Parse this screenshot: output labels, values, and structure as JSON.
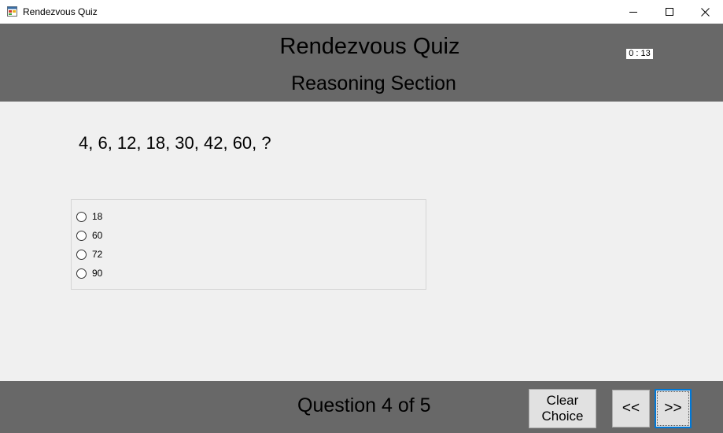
{
  "window": {
    "title": "Rendezvous Quiz",
    "controls": [
      "minimize",
      "maximize",
      "close"
    ]
  },
  "header": {
    "title": "Rendezvous Quiz",
    "section": "Reasoning Section",
    "timer": "0 : 13"
  },
  "question": {
    "text": "4, 6, 12, 18, 30, 42, 60, ?",
    "options": [
      {
        "label": "18",
        "selected": false
      },
      {
        "label": "60",
        "selected": false
      },
      {
        "label": "72",
        "selected": false
      },
      {
        "label": "90",
        "selected": false
      }
    ]
  },
  "footer": {
    "counter": "Question 4 of 5",
    "clear_label": "Clear\nChoice",
    "prev_label": "<<",
    "next_label": ">>"
  },
  "colors": {
    "header_bg": "#686868",
    "content_bg": "#f0f0f0",
    "button_bg": "#e1e1e1",
    "focus_border": "#0078d7"
  }
}
